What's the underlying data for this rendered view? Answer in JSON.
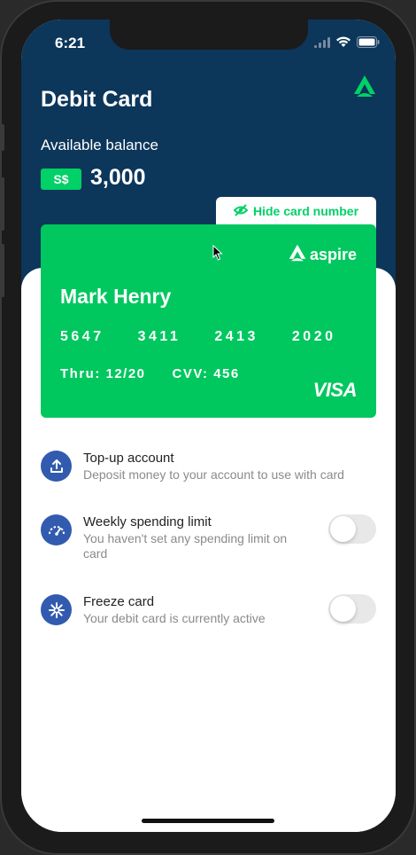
{
  "status_bar": {
    "time": "6:21",
    "icons": [
      "signal-icon",
      "wifi-icon",
      "battery-icon"
    ]
  },
  "header": {
    "title": "Debit Card",
    "balance_label": "Available balance",
    "currency": "S$",
    "balance": "3,000",
    "logo_icon": "aspire-logo-icon"
  },
  "card_toggle": {
    "label": "Hide card number",
    "icon": "eye-off-icon"
  },
  "card": {
    "brand": "aspire",
    "holder_name": "Mark Henry",
    "number_groups": [
      "5647",
      "3411",
      "2413",
      "2020"
    ],
    "expiry": "Thru: 12/20",
    "cvv": "CVV: 456",
    "network": "VISA"
  },
  "menu": [
    {
      "title": "Top-up account",
      "description": "Deposit money to your account to use with card",
      "icon": "upload-icon",
      "has_toggle": false
    },
    {
      "title": "Weekly spending limit",
      "description": "You haven't set any spending limit on card",
      "icon": "gauge-icon",
      "has_toggle": true,
      "toggle_on": false
    },
    {
      "title": "Freeze card",
      "description": "Your debit card is currently active",
      "icon": "snowflake-icon",
      "has_toggle": true,
      "toggle_on": false
    }
  ],
  "colors": {
    "header_bg": "#0c365a",
    "brand_green": "#01d167",
    "icon_blue": "#325baf"
  }
}
